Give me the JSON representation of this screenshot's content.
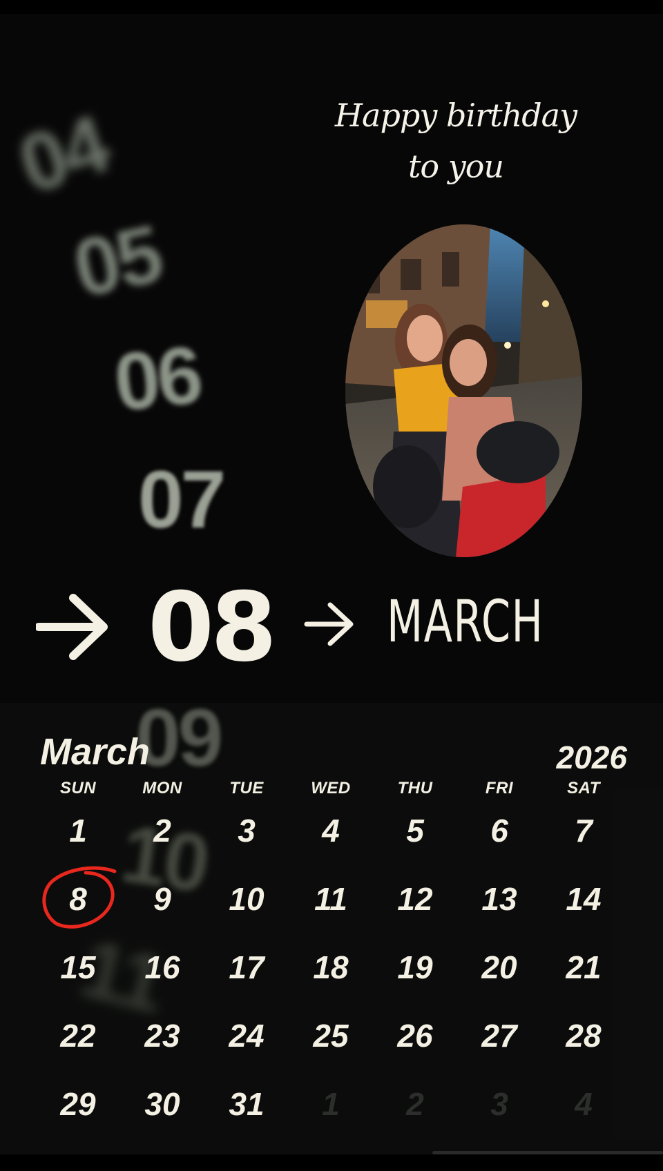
{
  "greeting": {
    "line1": "Happy birthday",
    "line2": "to you"
  },
  "wheel": {
    "blurred_numbers": [
      "04",
      "05",
      "06",
      "07",
      "09",
      "10",
      "11"
    ],
    "selected_day": "08",
    "selected_month": "MARCH"
  },
  "calendar": {
    "month": "March",
    "year": "2026",
    "weekdays": [
      "SUN",
      "MON",
      "TUE",
      "WED",
      "THU",
      "FRI",
      "SAT"
    ],
    "weeks": [
      [
        "1",
        "2",
        "3",
        "4",
        "5",
        "6",
        "7"
      ],
      [
        "8",
        "9",
        "10",
        "11",
        "12",
        "13",
        "14"
      ],
      [
        "15",
        "16",
        "17",
        "18",
        "19",
        "20",
        "21"
      ],
      [
        "22",
        "23",
        "24",
        "25",
        "26",
        "27",
        "28"
      ],
      [
        "29",
        "30",
        "31",
        "1",
        "2",
        "3",
        "4"
      ]
    ],
    "trailing_days_dimmed": 4,
    "highlighted_day": "8",
    "highlight_color": "#e8281e"
  },
  "colors": {
    "background": "#070707",
    "text": "#f4f1e4",
    "blur_number": "#8c9488"
  }
}
